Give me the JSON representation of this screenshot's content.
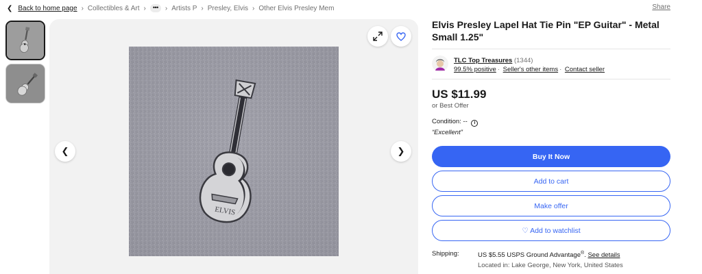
{
  "breadcrumb": {
    "back": "Back to home page",
    "items": [
      "Collectibles & Art",
      "Artists P",
      "Presley, Elvis",
      "Other Elvis Presley Mem"
    ],
    "more": "•••"
  },
  "share": "Share",
  "listing": {
    "title": "Elvis Presley Lapel Hat Tie Pin \"EP Guitar\" - Metal Small 1.25\"",
    "price": "US $11.99",
    "best_offer": "or Best Offer",
    "condition_label": "Condition: --",
    "condition_quote": "“Excellent”"
  },
  "seller": {
    "name": "TLC Top Treasures",
    "count": "(1344)",
    "positive": "99.5% positive",
    "other_items": "Seller's other items",
    "contact": "Contact seller"
  },
  "actions": {
    "buy": "Buy It Now",
    "cart": "Add to cart",
    "offer": "Make offer",
    "watch": "♡ Add to watchlist"
  },
  "shipping": {
    "label": "Shipping:",
    "value": "US $5.55 USPS Ground Advantage",
    "reg": "®",
    "details": "See details",
    "location": "Located in: Lake George, New York, United States"
  },
  "colors": {
    "accent": "#3665f3",
    "text": "#191919",
    "muted": "#707070",
    "stage": "#f2f2f2"
  }
}
